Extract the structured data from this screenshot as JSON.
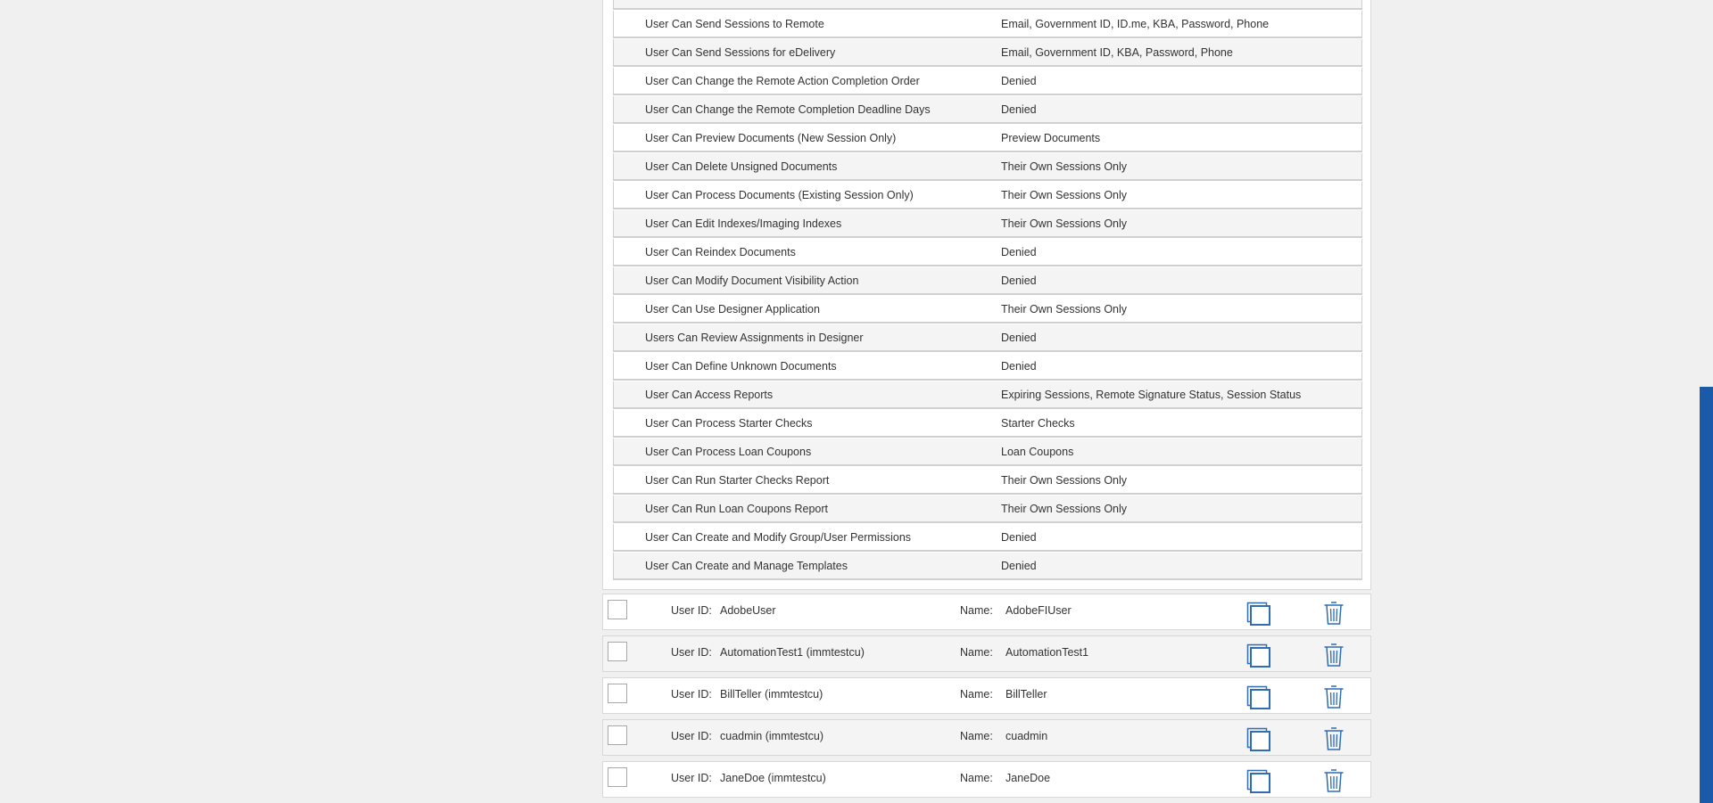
{
  "permissions": [
    {
      "name": "User Can Send Sessions to Remote",
      "value": "Email, Government ID, ID.me, KBA, Password, Phone"
    },
    {
      "name": "User Can Send Sessions for eDelivery",
      "value": "Email, Government ID, KBA, Password, Phone"
    },
    {
      "name": "User Can Change the Remote Action Completion Order",
      "value": "Denied"
    },
    {
      "name": "User Can Change the Remote Completion Deadline Days",
      "value": "Denied"
    },
    {
      "name": "User Can Preview Documents (New Session Only)",
      "value": "Preview Documents"
    },
    {
      "name": "User Can Delete Unsigned Documents",
      "value": "Their Own Sessions Only"
    },
    {
      "name": "User Can Process Documents (Existing Session Only)",
      "value": "Their Own Sessions Only"
    },
    {
      "name": "User Can Edit Indexes/Imaging Indexes",
      "value": "Their Own Sessions Only"
    },
    {
      "name": "User Can Reindex Documents",
      "value": "Denied"
    },
    {
      "name": "User Can Modify Document Visibility Action",
      "value": "Denied"
    },
    {
      "name": "User Can Use Designer Application",
      "value": "Their Own Sessions Only"
    },
    {
      "name": "Users Can Review Assignments in Designer",
      "value": "Denied"
    },
    {
      "name": "User Can Define Unknown Documents",
      "value": "Denied"
    },
    {
      "name": "User Can Access Reports",
      "value": "Expiring Sessions, Remote Signature Status, Session Status"
    },
    {
      "name": "User Can Process Starter Checks",
      "value": "Starter Checks"
    },
    {
      "name": "User Can Process Loan Coupons",
      "value": "Loan Coupons"
    },
    {
      "name": "User Can Run Starter Checks Report",
      "value": "Their Own Sessions Only"
    },
    {
      "name": "User Can Run Loan Coupons Report",
      "value": "Their Own Sessions Only"
    },
    {
      "name": "User Can Create and Modify Group/User Permissions",
      "value": "Denied"
    },
    {
      "name": "User Can Create and Manage Templates",
      "value": "Denied"
    }
  ],
  "user_labels": {
    "user_id": "User ID:",
    "name": "Name:"
  },
  "users": [
    {
      "user_id": "AdobeUser",
      "name": "AdobeFIUser"
    },
    {
      "user_id": "AutomationTest1 (immtestcu)",
      "name": "AutomationTest1"
    },
    {
      "user_id": "BillTeller (immtestcu)",
      "name": "BillTeller"
    },
    {
      "user_id": "cuadmin (immtestcu)",
      "name": "cuadmin"
    },
    {
      "user_id": "JaneDoe (immtestcu)",
      "name": "JaneDoe"
    }
  ],
  "colors": {
    "accent": "#1a5aa8",
    "icon": "#2f6db5",
    "row_alt": "#f4f4f4",
    "border": "#d0d0d0"
  },
  "icons": {
    "copy": "copy-icon",
    "delete": "trash-icon",
    "checkbox": "checkbox-icon"
  }
}
